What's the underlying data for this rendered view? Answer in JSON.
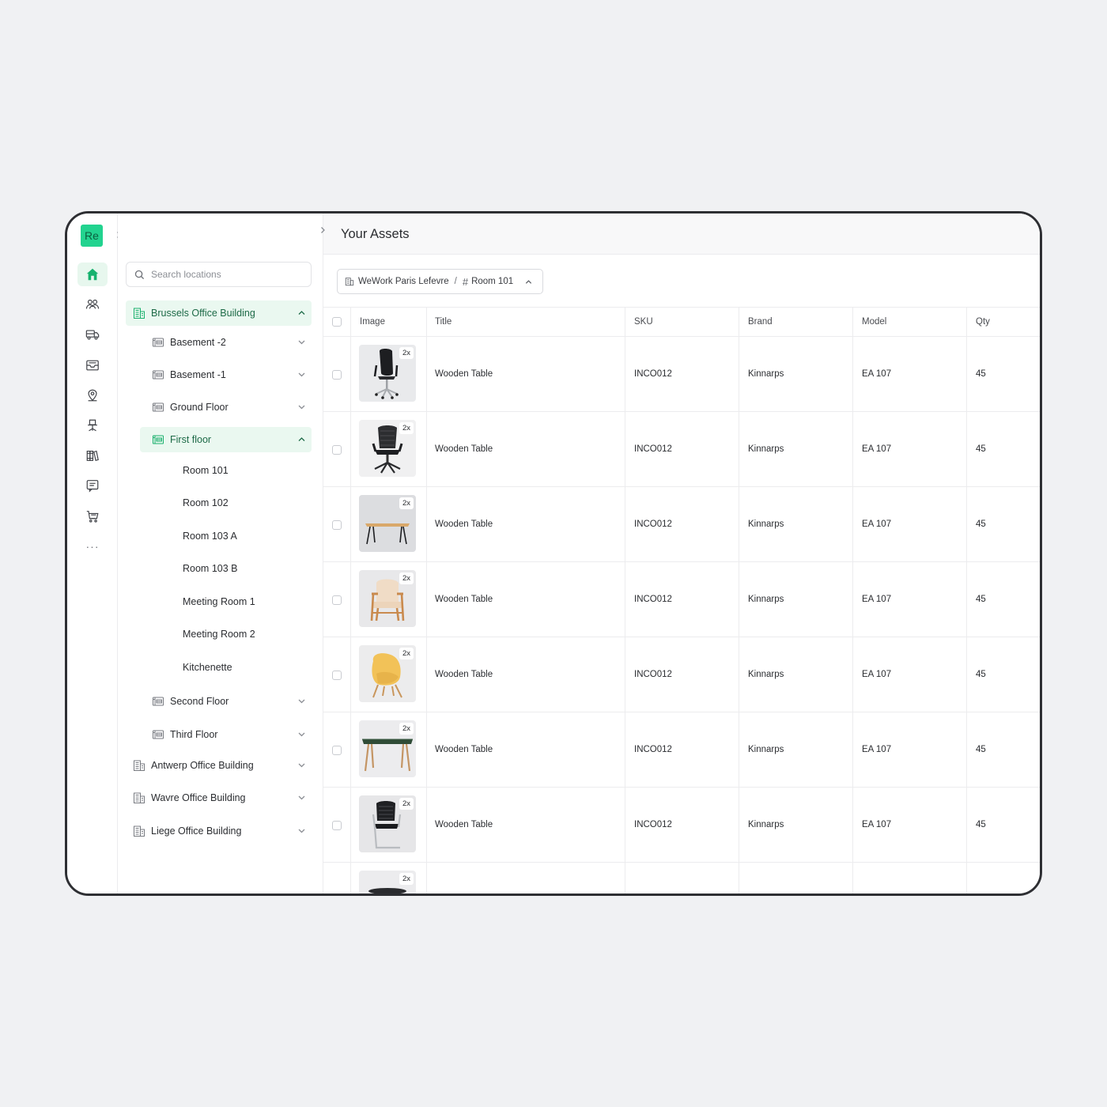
{
  "app": {
    "logo_text": "Re"
  },
  "rail": {
    "icons": [
      "home-icon",
      "users-icon",
      "truck-icon",
      "inbox-icon",
      "map-pin-icon",
      "office-chair-icon",
      "books-icon",
      "message-icon",
      "cart-icon",
      "more-icon"
    ],
    "more_glyph": "···",
    "active_color": "#16b26e"
  },
  "locations": {
    "search_placeholder": "Search locations",
    "tree": [
      {
        "label": "Brussels Office Building",
        "level": 0,
        "type": "building",
        "state": "expanded",
        "active": true
      },
      {
        "label": "Basement -2",
        "level": 1,
        "type": "floor",
        "state": "collapsed"
      },
      {
        "label": "Basement -1",
        "level": 1,
        "type": "floor",
        "state": "collapsed"
      },
      {
        "label": "Ground Floor",
        "level": 1,
        "type": "floor",
        "state": "collapsed"
      },
      {
        "label": "First floor",
        "level": 1,
        "type": "floor",
        "state": "expanded",
        "active": true
      },
      {
        "label": "Room 101",
        "level": 2,
        "type": "room"
      },
      {
        "label": "Room 102",
        "level": 2,
        "type": "room"
      },
      {
        "label": "Room 103 A",
        "level": 2,
        "type": "room"
      },
      {
        "label": "Room 103 B",
        "level": 2,
        "type": "room"
      },
      {
        "label": "Meeting Room 1",
        "level": 2,
        "type": "room"
      },
      {
        "label": "Meeting Room 2",
        "level": 2,
        "type": "room"
      },
      {
        "label": "Kitchenette",
        "level": 2,
        "type": "room"
      },
      {
        "label": "Second Floor",
        "level": 1,
        "type": "floor",
        "state": "collapsed"
      },
      {
        "label": "Third Floor",
        "level": 1,
        "type": "floor",
        "state": "collapsed"
      },
      {
        "label": "Antwerp Office Building",
        "level": 0,
        "type": "building",
        "state": "collapsed"
      },
      {
        "label": "Wavre Office Building",
        "level": 0,
        "type": "building",
        "state": "collapsed"
      },
      {
        "label": "Liege Office Building",
        "level": 0,
        "type": "building",
        "state": "collapsed"
      }
    ]
  },
  "main": {
    "title": "Your Assets",
    "breadcrumb": {
      "building": "WeWork Paris Lefevre",
      "separator": "/",
      "room": "Room 101"
    },
    "table": {
      "columns": [
        "Image",
        "Title",
        "SKU",
        "Brand",
        "Model",
        "Qty"
      ],
      "rows": [
        {
          "image": "office-chair-black-highback",
          "badge": "2x",
          "title": "Wooden Table",
          "sku": "INCO012",
          "brand": "Kinnarps",
          "model": "EA 107",
          "qty": "45"
        },
        {
          "image": "office-chair-black-mesh",
          "badge": "2x",
          "title": "Wooden Table",
          "sku": "INCO012",
          "brand": "Kinnarps",
          "model": "EA 107",
          "qty": "45"
        },
        {
          "image": "wooden-desk",
          "badge": "2x",
          "title": "Wooden Table",
          "sku": "INCO012",
          "brand": "Kinnarps",
          "model": "EA 107",
          "qty": "45"
        },
        {
          "image": "wooden-lounge-chair",
          "badge": "2x",
          "title": "Wooden Table",
          "sku": "INCO012",
          "brand": "Kinnarps",
          "model": "EA 107",
          "qty": "45"
        },
        {
          "image": "yellow-lounge-chair",
          "badge": "2x",
          "title": "Wooden Table",
          "sku": "INCO012",
          "brand": "Kinnarps",
          "model": "EA 107",
          "qty": "45"
        },
        {
          "image": "green-top-table",
          "badge": "2x",
          "title": "Wooden Table",
          "sku": "INCO012",
          "brand": "Kinnarps",
          "model": "EA 107",
          "qty": "45"
        },
        {
          "image": "cantilever-chair",
          "badge": "2x",
          "title": "Wooden Table",
          "sku": "INCO012",
          "brand": "Kinnarps",
          "model": "EA 107",
          "qty": "45"
        },
        {
          "image": "round-table",
          "badge": "2x",
          "title": "",
          "sku": "",
          "brand": "",
          "model": "",
          "qty": ""
        }
      ]
    }
  }
}
